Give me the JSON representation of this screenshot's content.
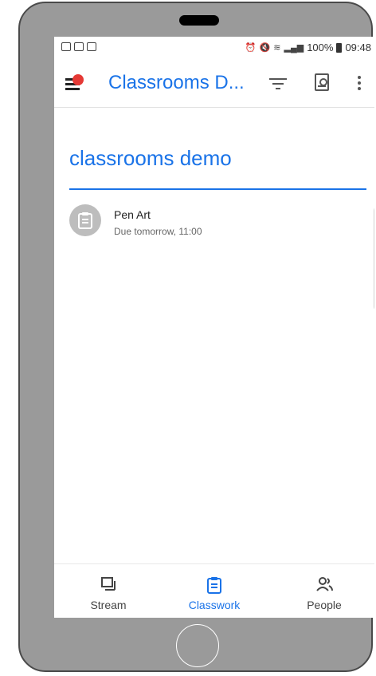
{
  "status_bar": {
    "battery_percent": "100%",
    "time": "09:48"
  },
  "app_bar": {
    "title": "Classrooms D..."
  },
  "classroom": {
    "name": "classrooms demo"
  },
  "assignments": [
    {
      "title": "Pen Art",
      "due": "Due tomorrow, 11:00"
    }
  ],
  "bottom_nav": {
    "items": [
      {
        "label": "Stream",
        "icon": "stream-icon",
        "active": false
      },
      {
        "label": "Classwork",
        "icon": "classwork-icon",
        "active": true
      },
      {
        "label": "People",
        "icon": "people-icon",
        "active": false
      }
    ]
  },
  "colors": {
    "accent": "#1a73e8",
    "notification_dot": "#e53935",
    "phone_frame": "#9a9a9a"
  }
}
